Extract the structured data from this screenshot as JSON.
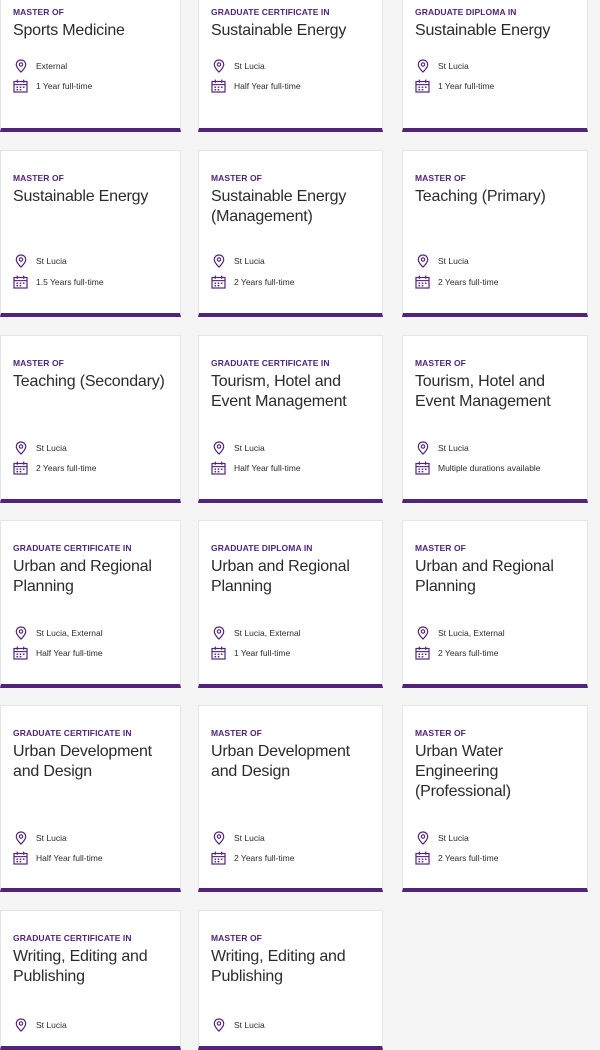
{
  "theme": {
    "accent": "#51247a",
    "card_background": "#ffffff",
    "page_background": "#f5f5f5",
    "text": "#2b2b2b"
  },
  "icons": {
    "location": "location-pin-icon",
    "duration": "calendar-icon"
  },
  "programs": [
    {
      "level": "MASTER OF",
      "title": "Sports Medicine",
      "location": "External",
      "duration": "1 Year full-time"
    },
    {
      "level": "GRADUATE CERTIFICATE IN",
      "title": "Sustainable Energy",
      "location": "St Lucia",
      "duration": "Half Year full-time"
    },
    {
      "level": "GRADUATE DIPLOMA IN",
      "title": "Sustainable Energy",
      "location": "St Lucia",
      "duration": "1 Year full-time"
    },
    {
      "level": "MASTER OF",
      "title": "Sustainable Energy",
      "location": "St Lucia",
      "duration": "1.5 Years full-time"
    },
    {
      "level": "MASTER OF",
      "title": "Sustainable Energy (Management)",
      "location": "St Lucia",
      "duration": "2 Years full-time"
    },
    {
      "level": "MASTER OF",
      "title": "Teaching (Primary)",
      "location": "St Lucia",
      "duration": "2 Years full-time"
    },
    {
      "level": "MASTER OF",
      "title": "Teaching (Secondary)",
      "location": "St Lucia",
      "duration": "2 Years full-time"
    },
    {
      "level": "GRADUATE CERTIFICATE IN",
      "title": "Tourism, Hotel and Event Management",
      "location": "St Lucia",
      "duration": "Half Year full-time"
    },
    {
      "level": "MASTER OF",
      "title": "Tourism, Hotel and Event Management",
      "location": "St Lucia",
      "duration": "Multiple durations available"
    },
    {
      "level": "GRADUATE CERTIFICATE IN",
      "title": "Urban and Regional Planning",
      "location": "St Lucia, External",
      "duration": "Half Year full-time"
    },
    {
      "level": "GRADUATE DIPLOMA IN",
      "title": "Urban and Regional Planning",
      "location": "St Lucia, External",
      "duration": "1 Year full-time"
    },
    {
      "level": "MASTER OF",
      "title": "Urban and Regional Planning",
      "location": "St Lucia, External",
      "duration": "2 Years full-time"
    },
    {
      "level": "GRADUATE CERTIFICATE IN",
      "title": "Urban Development and Design",
      "location": "St Lucia",
      "duration": "Half Year full-time"
    },
    {
      "level": "MASTER OF",
      "title": "Urban Development and Design",
      "location": "St Lucia",
      "duration": "2 Years full-time"
    },
    {
      "level": "MASTER OF",
      "title": "Urban Water Engineering (Professional)",
      "location": "St Lucia",
      "duration": "2 Years full-time"
    },
    {
      "level": "GRADUATE CERTIFICATE IN",
      "title": "Writing, Editing and Publishing",
      "location": "St Lucia",
      "duration": ""
    },
    {
      "level": "MASTER OF",
      "title": "Writing, Editing and Publishing",
      "location": "St Lucia",
      "duration": ""
    }
  ]
}
